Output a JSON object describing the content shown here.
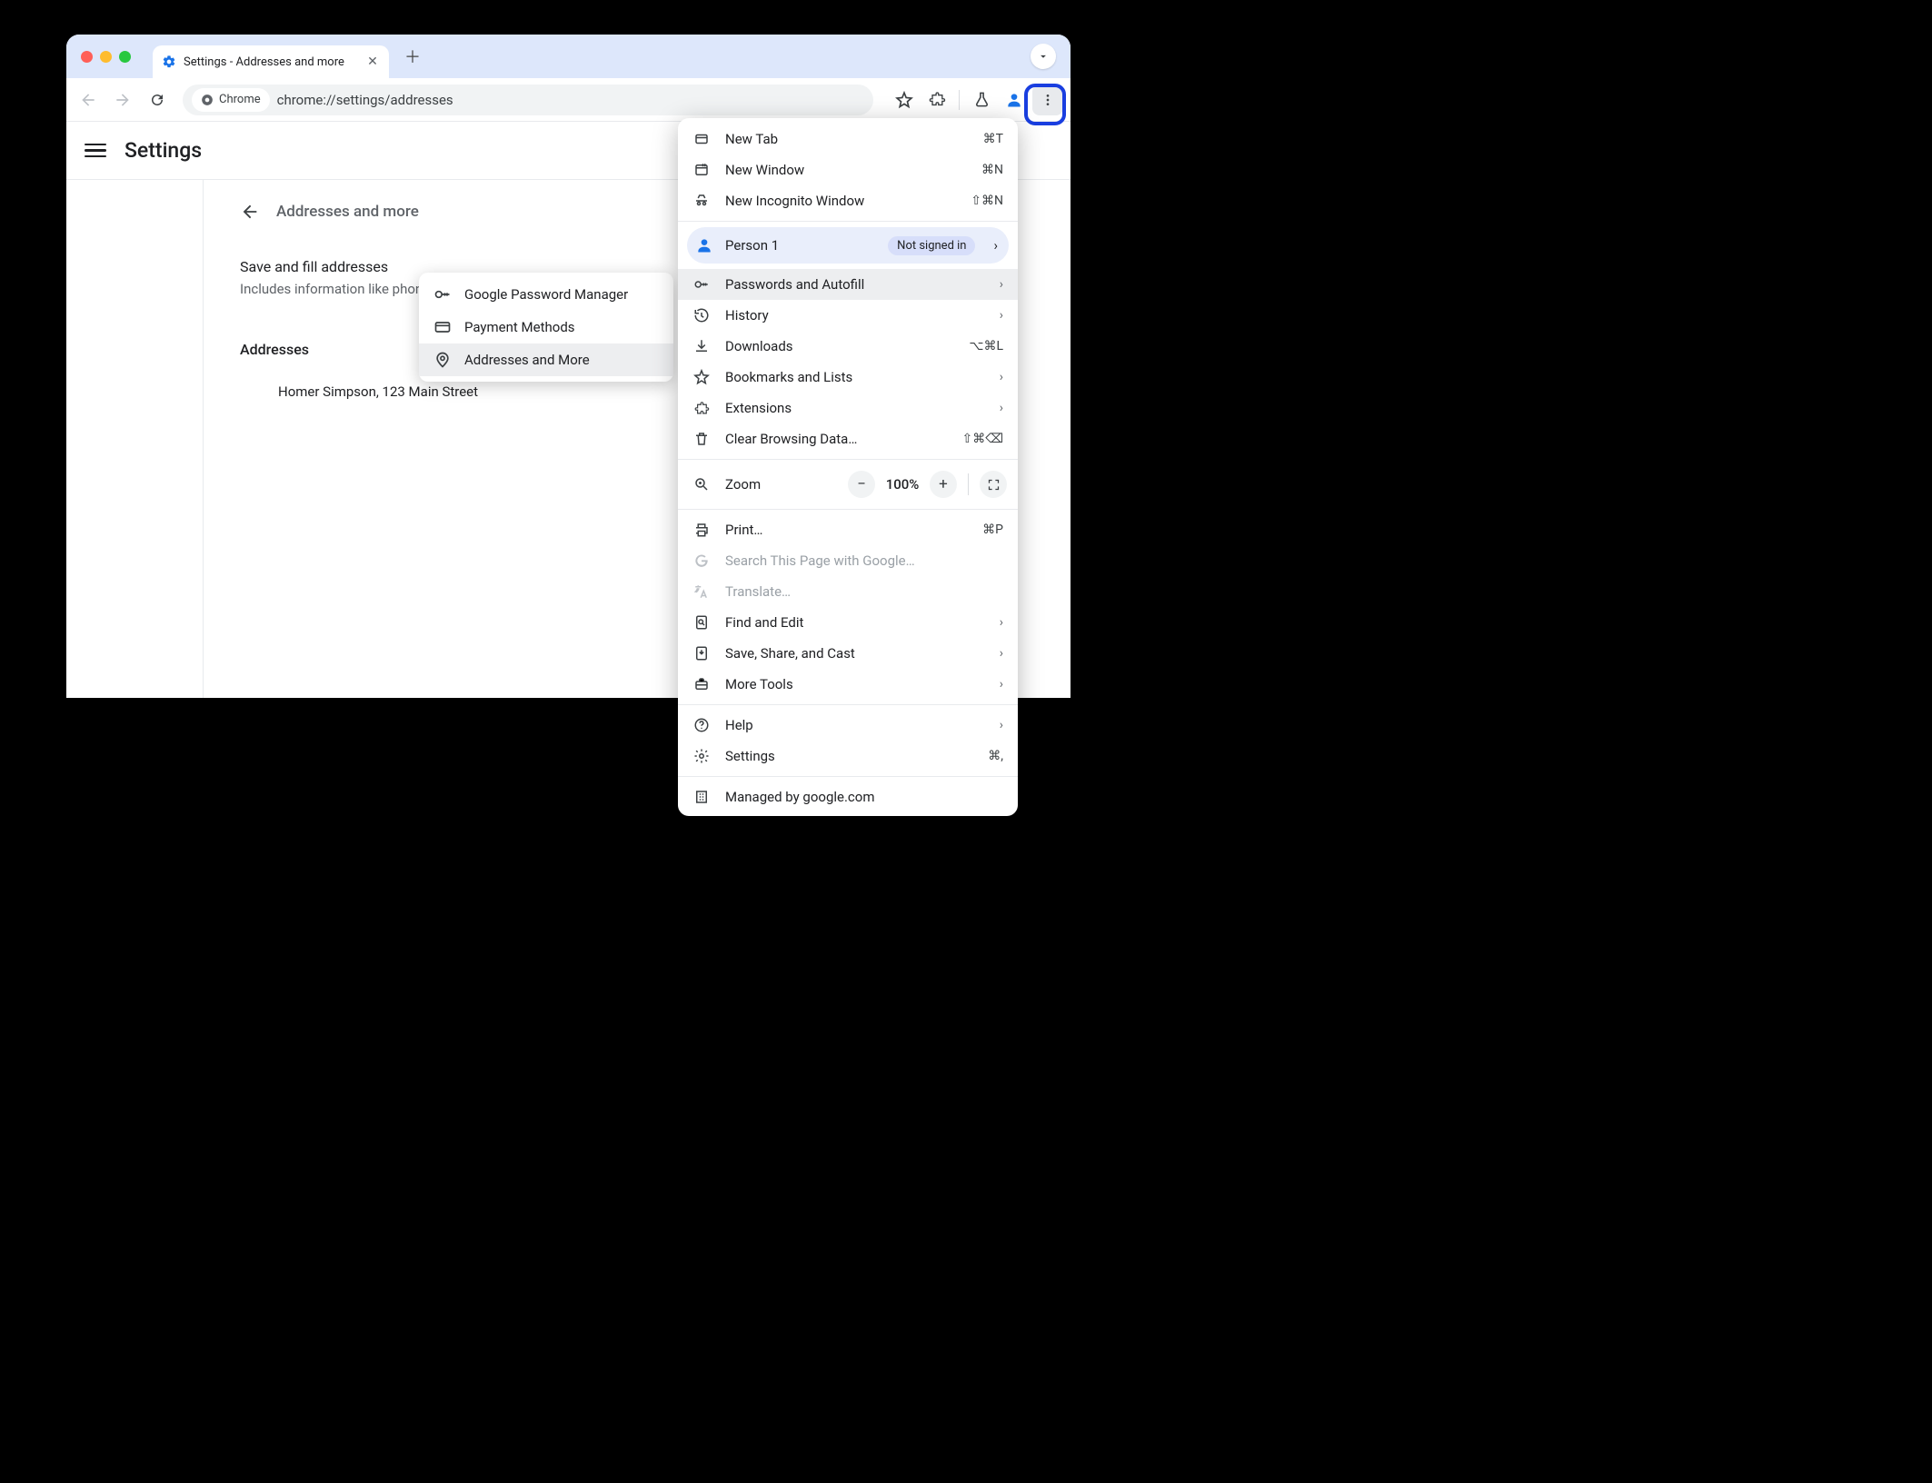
{
  "tab": {
    "title": "Settings - Addresses and more"
  },
  "omnibox": {
    "chip": "Chrome",
    "url": "chrome://settings/addresses"
  },
  "page": {
    "title": "Settings",
    "breadcrumb": "Addresses and more",
    "save_row": "Save and fill addresses",
    "save_sub": "Includes information like phon",
    "addresses_head": "Addresses",
    "address_entry": "Homer Simpson, 123 Main Street"
  },
  "submenu": {
    "items": [
      {
        "label": "Google Password Manager"
      },
      {
        "label": "Payment Methods"
      },
      {
        "label": "Addresses and More"
      }
    ]
  },
  "menu": {
    "new_tab": {
      "label": "New Tab",
      "shortcut": "⌘T"
    },
    "new_window": {
      "label": "New Window",
      "shortcut": "⌘N"
    },
    "new_incognito": {
      "label": "New Incognito Window",
      "shortcut": "⇧⌘N"
    },
    "profile": {
      "name": "Person 1",
      "badge": "Not signed in"
    },
    "passwords": {
      "label": "Passwords and Autofill"
    },
    "history": {
      "label": "History"
    },
    "downloads": {
      "label": "Downloads",
      "shortcut": "⌥⌘L"
    },
    "bookmarks": {
      "label": "Bookmarks and Lists"
    },
    "extensions": {
      "label": "Extensions"
    },
    "clear_data": {
      "label": "Clear Browsing Data…",
      "shortcut": "⇧⌘⌫"
    },
    "zoom": {
      "label": "Zoom",
      "level": "100%"
    },
    "print": {
      "label": "Print…",
      "shortcut": "⌘P"
    },
    "search_page": {
      "label": "Search This Page with Google…"
    },
    "translate": {
      "label": "Translate…"
    },
    "find": {
      "label": "Find and Edit"
    },
    "save_share": {
      "label": "Save, Share, and Cast"
    },
    "more_tools": {
      "label": "More Tools"
    },
    "help": {
      "label": "Help"
    },
    "settings": {
      "label": "Settings",
      "shortcut": "⌘,"
    },
    "managed": {
      "label": "Managed by google.com"
    }
  }
}
